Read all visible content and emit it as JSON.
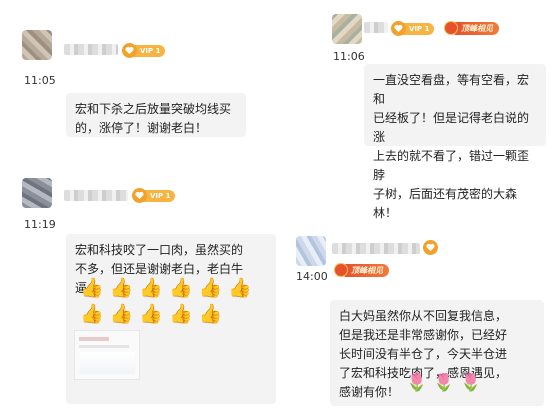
{
  "vip_label": "VIP 1",
  "badge_label": "顶峰相见",
  "messages": [
    {
      "time": "11:05",
      "text_lines": [
        "宏和下杀之后放量突破均线买",
        "的，涨停了！谢谢老白！"
      ]
    },
    {
      "time": "11:06",
      "text_lines": [
        "一直没空看盘，等有空看，宏和",
        "已经板了！但是记得老白说的涨",
        "上去的就不看了，错过一颗歪脖",
        "子树，后面还有茂密的大森林！"
      ]
    },
    {
      "time": "11:19",
      "text_lines": [
        "宏和科技咬了一口肉，虽然买的",
        "不多，但还是谢谢老白，老白牛",
        "逼"
      ],
      "thumbs_count": 11,
      "thumb_glyph": "👍"
    },
    {
      "time": "14:00",
      "text_lines": [
        "白大妈虽然你从不回复我信息，",
        "但是我还是非常感谢你，已经好",
        "长时间没有半仓了，今天半仓进",
        "了宏和科技吃肉了，感恩遇见，",
        "感谢有你！"
      ],
      "tulip_count": 3,
      "tulip_glyph": "🌷"
    }
  ],
  "colors": {
    "bubble": "#f3f3f3",
    "vip": "#f7b443",
    "badge": "#e5522c"
  }
}
